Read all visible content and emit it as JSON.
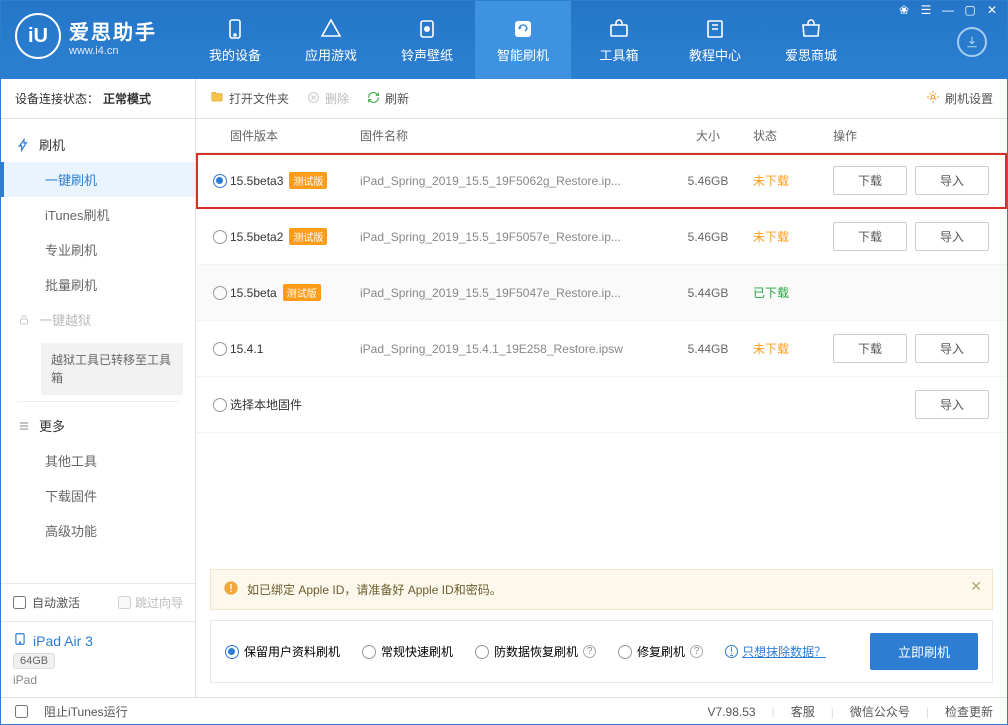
{
  "app": {
    "name": "爱思助手",
    "url": "www.i4.cn",
    "logo_letter": "iU"
  },
  "top_tabs": [
    {
      "id": "device",
      "label": "我的设备"
    },
    {
      "id": "apps",
      "label": "应用游戏"
    },
    {
      "id": "ring",
      "label": "铃声壁纸"
    },
    {
      "id": "flash",
      "label": "智能刷机",
      "active": true
    },
    {
      "id": "tools",
      "label": "工具箱"
    },
    {
      "id": "tutorial",
      "label": "教程中心"
    },
    {
      "id": "store",
      "label": "爱思商城"
    }
  ],
  "sidebar": {
    "conn_label": "设备连接状态：",
    "conn_value": "正常模式",
    "flash_group": "刷机",
    "items": [
      {
        "label": "一键刷机",
        "active": true
      },
      {
        "label": "iTunes刷机"
      },
      {
        "label": "专业刷机"
      },
      {
        "label": "批量刷机"
      }
    ],
    "jailbreak": "一键越狱",
    "jailbreak_notice": "越狱工具已转移至工具箱",
    "more": "更多",
    "more_items": [
      {
        "label": "其他工具"
      },
      {
        "label": "下载固件"
      },
      {
        "label": "高级功能"
      }
    ],
    "auto_activate": "自动激活",
    "skip_guide": "跳过向导",
    "device": {
      "name": "iPad Air 3",
      "capacity": "64GB",
      "type": "iPad"
    }
  },
  "toolbar": {
    "open": "打开文件夹",
    "delete": "删除",
    "refresh": "刷新",
    "settings": "刷机设置"
  },
  "columns": {
    "version": "固件版本",
    "name": "固件名称",
    "size": "大小",
    "status": "状态",
    "ops": "操作"
  },
  "badge_beta": "测试版",
  "buttons": {
    "download": "下载",
    "import": "导入"
  },
  "status_labels": {
    "not_downloaded": "未下载",
    "downloaded": "已下载"
  },
  "firmware": [
    {
      "version": "15.5beta3",
      "beta": true,
      "name": "iPad_Spring_2019_15.5_19F5062g_Restore.ip...",
      "size": "5.46GB",
      "status": "not_downloaded",
      "selected": true,
      "show_dl": true
    },
    {
      "version": "15.5beta2",
      "beta": true,
      "name": "iPad_Spring_2019_15.5_19F5057e_Restore.ip...",
      "size": "5.46GB",
      "status": "not_downloaded",
      "show_dl": true
    },
    {
      "version": "15.5beta",
      "beta": true,
      "name": "iPad_Spring_2019_15.5_19F5047e_Restore.ip...",
      "size": "5.44GB",
      "status": "downloaded",
      "show_dl": false,
      "alt": true
    },
    {
      "version": "15.4.1",
      "beta": false,
      "name": "iPad_Spring_2019_15.4.1_19E258_Restore.ipsw",
      "size": "5.44GB",
      "status": "not_downloaded",
      "show_dl": true
    }
  ],
  "local_row": {
    "label": "选择本地固件"
  },
  "warning": "如已绑定 Apple ID，请准备好 Apple ID和密码。",
  "flash_options": [
    {
      "label": "保留用户资料刷机",
      "selected": true,
      "q": false
    },
    {
      "label": "常规快速刷机",
      "q": false
    },
    {
      "label": "防数据恢复刷机",
      "q": true
    },
    {
      "label": "修复刷机",
      "q": true
    }
  ],
  "erase_link": "只想抹除数据？",
  "flash_now": "立即刷机",
  "statusbar": {
    "block_itunes": "阻止iTunes运行",
    "version": "V7.98.53",
    "service": "客服",
    "wechat": "微信公众号",
    "update": "检查更新"
  }
}
